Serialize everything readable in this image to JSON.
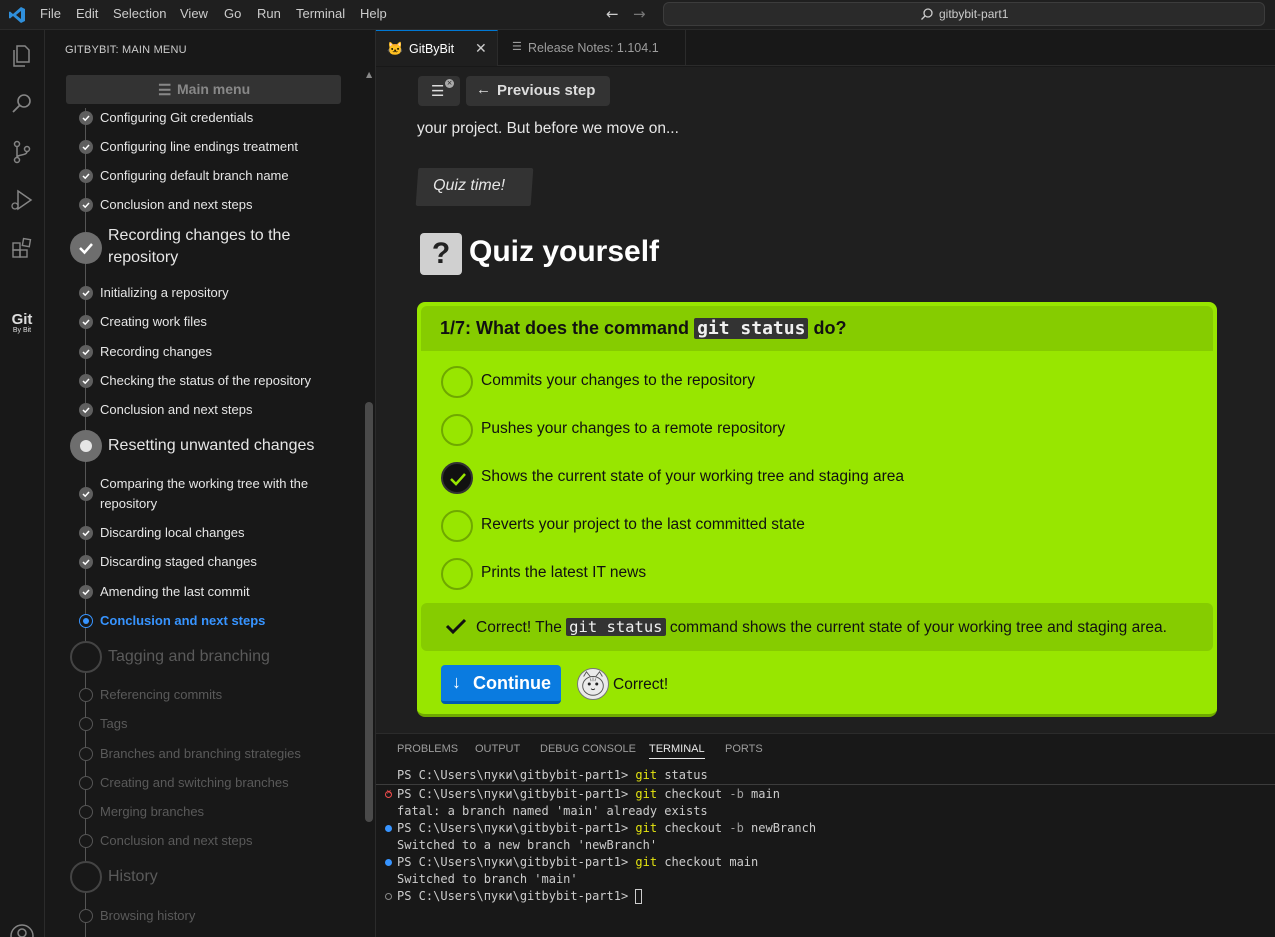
{
  "titlebar": {
    "menu": [
      "File",
      "Edit",
      "Selection",
      "View",
      "Go",
      "Run",
      "Terminal",
      "Help"
    ],
    "search": "gitbybit-part1"
  },
  "sidebar": {
    "title": "GITBYBIT: MAIN MENU",
    "main_menu_label": "Main menu",
    "items": [
      {
        "label": "Configuring Git credentials",
        "state": "done"
      },
      {
        "label": "Configuring line endings treatment",
        "state": "done"
      },
      {
        "label": "Configuring default branch name",
        "state": "done"
      },
      {
        "label": "Conclusion and next steps",
        "state": "done"
      },
      {
        "label": "Initializing a repository",
        "state": "done"
      },
      {
        "label": "Creating work files",
        "state": "done"
      },
      {
        "label": "Recording changes",
        "state": "done"
      },
      {
        "label": "Checking the status of the repository",
        "state": "done"
      },
      {
        "label": "Conclusion and next steps",
        "state": "done"
      },
      {
        "label": "Comparing the working tree with the",
        "label2": "repository",
        "state": "done"
      },
      {
        "label": "Discarding local changes",
        "state": "done"
      },
      {
        "label": "Discarding staged changes",
        "state": "done"
      },
      {
        "label": "Amending the last commit",
        "state": "done"
      },
      {
        "label": "Conclusion and next steps",
        "state": "current"
      },
      {
        "label": "Referencing commits",
        "state": "future"
      },
      {
        "label": "Tags",
        "state": "future"
      },
      {
        "label": "Branches and branching strategies",
        "state": "future"
      },
      {
        "label": "Creating and switching branches",
        "state": "future"
      },
      {
        "label": "Merging branches",
        "state": "future"
      },
      {
        "label": "Conclusion and next steps",
        "state": "future"
      },
      {
        "label": "Browsing history",
        "state": "future"
      }
    ],
    "sections": [
      {
        "title1": "Recording changes to the",
        "title2": "repository",
        "state": "done"
      },
      {
        "title1": "Resetting unwanted changes",
        "state": "partial"
      },
      {
        "title1": "Tagging and branching",
        "state": "future"
      },
      {
        "title1": "History",
        "state": "future"
      }
    ]
  },
  "tabs": [
    {
      "label": "GitByBit",
      "active": true
    },
    {
      "label": "Release Notes: 1.104.1",
      "active": false
    }
  ],
  "editor": {
    "prev_step": "Previous step",
    "intro": "your project. But before we move on...",
    "quiz_time": "Quiz time!",
    "heading": "Quiz yourself",
    "question_prefix": "1/7: What does the command",
    "question_code": "git status",
    "question_suffix": "do?",
    "options": [
      {
        "label": "Commits your changes to the repository",
        "selected": false
      },
      {
        "label": "Pushes your changes to a remote repository",
        "selected": false
      },
      {
        "label": "Shows the current state of your working tree and staging area",
        "selected": true
      },
      {
        "label": "Reverts your project to the last committed state",
        "selected": false
      },
      {
        "label": "Prints the latest IT news",
        "selected": false
      }
    ],
    "feedback_prefix": "Correct! The",
    "feedback_code": "git status",
    "feedback_suffix": "command shows the current state of your working tree and staging area.",
    "continue": "Continue",
    "cat_text": "Correct!",
    "colors": {
      "card": "#98e600",
      "card_header": "#86cc00",
      "button": "#0a7be0"
    }
  },
  "panel": {
    "tabs": [
      "PROBLEMS",
      "OUTPUT",
      "DEBUG CONSOLE",
      "TERMINAL",
      "PORTS"
    ],
    "active_tab": "TERMINAL",
    "prompt": "PS C:\\Users\\пуки\\gitbybit-part1>",
    "lines": [
      {
        "type": "cmd",
        "cmd": "git",
        "args": " status",
        "flag": "",
        "status": "none"
      },
      {
        "type": "cmd",
        "cmd": "git",
        "args": " checkout ",
        "flag": "-b",
        "args2": " main",
        "status": "error"
      },
      {
        "type": "out",
        "text": "fatal: a branch named 'main' already exists"
      },
      {
        "type": "cmd",
        "cmd": "git",
        "args": " checkout ",
        "flag": "-b",
        "args2": " newBranch",
        "status": "ok"
      },
      {
        "type": "out",
        "text": "Switched to a new branch 'newBranch'"
      },
      {
        "type": "cmd",
        "cmd": "git",
        "args": " checkout main",
        "flag": "",
        "status": "ok"
      },
      {
        "type": "out",
        "text": "Switched to branch 'main'"
      },
      {
        "type": "prompt",
        "status": "idle"
      }
    ]
  }
}
